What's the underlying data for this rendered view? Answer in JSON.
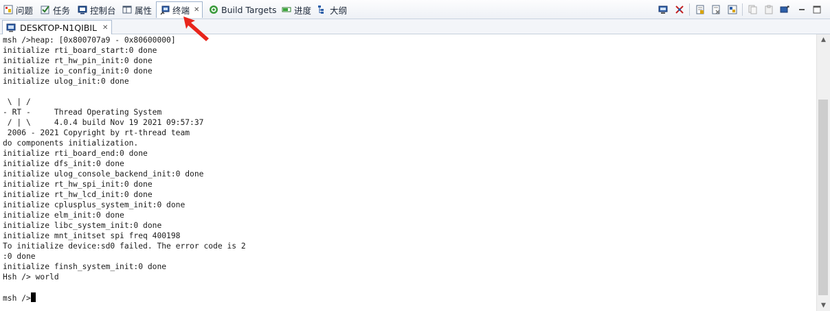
{
  "tabs": [
    {
      "label": "问题",
      "icon": "problems-icon"
    },
    {
      "label": "任务",
      "icon": "tasks-icon"
    },
    {
      "label": "控制台",
      "icon": "console-icon"
    },
    {
      "label": "属性",
      "icon": "properties-icon"
    },
    {
      "label": "终端",
      "icon": "terminal-icon",
      "active": true
    },
    {
      "label": "Build Targets",
      "icon": "build-targets-icon"
    },
    {
      "label": "进度",
      "icon": "progress-icon"
    },
    {
      "label": "大纲",
      "icon": "outline-icon"
    }
  ],
  "toolbar": [
    "connect-icon",
    "disconnect-icon",
    "scroll-lock-icon",
    "clear-console-icon",
    "settings-icon",
    "copy-icon",
    "paste-icon",
    "display-icon",
    "minimize-icon",
    "maximize-icon"
  ],
  "session_tab": {
    "label": "DESKTOP-N1QIBIL",
    "icon": "terminal-session-icon"
  },
  "console": {
    "lines": [
      "msh />heap: [0x800707a9 - 0x80600000]",
      "initialize rti_board_start:0 done",
      "initialize rt_hw_pin_init:0 done",
      "initialize io_config_init:0 done",
      "initialize ulog_init:0 done",
      "",
      " \\ | /",
      "- RT -     Thread Operating System",
      " / | \\     4.0.4 build Nov 19 2021 09:57:37",
      " 2006 - 2021 Copyright by rt-thread team",
      "do components initialization.",
      "initialize rti_board_end:0 done",
      "initialize dfs_init:0 done",
      "initialize ulog_console_backend_init:0 done",
      "initialize rt_hw_spi_init:0 done",
      "initialize rt_hw_lcd_init:0 done",
      "initialize cplusplus_system_init:0 done",
      "initialize elm_init:0 done",
      "initialize libc_system_init:0 done",
      "initialize mnt_initset spi freq 400198",
      "To initialize device:sd0 failed. The error code is 2",
      ":0 done",
      "initialize finsh_system_init:0 done",
      "Hsh /> world",
      ""
    ],
    "prompt": "msh />"
  },
  "colors": {
    "annotation_arrow": "#e8251c",
    "tab_border": "#9fb3cc"
  }
}
